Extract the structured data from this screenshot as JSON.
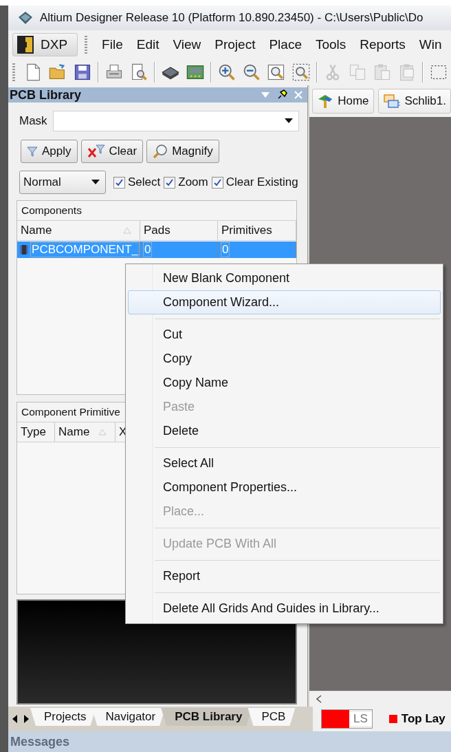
{
  "window": {
    "title": "Altium Designer Release 10 (Platform 10.890.23450) - C:\\Users\\Public\\Do"
  },
  "menu_bar": {
    "dxp": {
      "label": "DXP"
    },
    "items": [
      {
        "label": "File"
      },
      {
        "label": "Edit"
      },
      {
        "label": "View"
      },
      {
        "label": "Project"
      },
      {
        "label": "Place"
      },
      {
        "label": "Tools"
      },
      {
        "label": "Reports"
      },
      {
        "label": "Win"
      }
    ]
  },
  "panel": {
    "title": "PCB Library",
    "mask": {
      "label": "Mask"
    },
    "buttons": [
      {
        "label": "Apply",
        "kind": "apply"
      },
      {
        "label": "Clear",
        "kind": "clear"
      },
      {
        "label": "Magnify",
        "kind": "magnify"
      }
    ],
    "mode_select": {
      "value": "Normal"
    },
    "checkboxes": [
      {
        "label": "Select",
        "checked": true
      },
      {
        "label": "Zoom",
        "checked": true
      },
      {
        "label": "Clear Existing",
        "checked": true
      }
    ],
    "components": {
      "title": "Components",
      "columns": [
        {
          "label": "Name",
          "sorted": true
        },
        {
          "label": "Pads",
          "sorted": false
        },
        {
          "label": "Primitives",
          "sorted": false
        }
      ],
      "rows": [
        {
          "cells": [
            "PCBCOMPONENT_",
            "0",
            "0"
          ],
          "selected": true
        }
      ]
    },
    "primitives": {
      "title": "Component Primitive",
      "columns": [
        {
          "label": "Type"
        },
        {
          "label": "Name",
          "sorted": true
        },
        {
          "label": "X"
        }
      ]
    }
  },
  "doc_tabs": [
    {
      "label": "Home",
      "kind": "home"
    },
    {
      "label": "Schlib1.",
      "kind": "schlib"
    }
  ],
  "context_menu": [
    {
      "kind": "item",
      "label": "New Blank Component",
      "disabled": false,
      "selected": false
    },
    {
      "kind": "item",
      "label": "Component Wizard...",
      "disabled": false,
      "selected": true
    },
    {
      "kind": "separator"
    },
    {
      "kind": "item",
      "label": "Cut",
      "disabled": false,
      "selected": false
    },
    {
      "kind": "item",
      "label": "Copy",
      "disabled": false,
      "selected": false
    },
    {
      "kind": "item",
      "label": "Copy Name",
      "disabled": false,
      "selected": false
    },
    {
      "kind": "item",
      "label": "Paste",
      "disabled": true,
      "selected": false
    },
    {
      "kind": "item",
      "label": "Delete",
      "disabled": false,
      "selected": false
    },
    {
      "kind": "separator"
    },
    {
      "kind": "item",
      "label": "Select All",
      "disabled": false,
      "selected": false
    },
    {
      "kind": "item",
      "label": "Component Properties...",
      "disabled": false,
      "selected": false
    },
    {
      "kind": "item",
      "label": "Place...",
      "disabled": true,
      "selected": false
    },
    {
      "kind": "separator"
    },
    {
      "kind": "item",
      "label": "Update PCB With All",
      "disabled": true,
      "selected": false
    },
    {
      "kind": "separator"
    },
    {
      "kind": "item",
      "label": "Report",
      "disabled": false,
      "selected": false
    },
    {
      "kind": "separator"
    },
    {
      "kind": "item",
      "label": "Delete All Grids And Guides in Library...",
      "disabled": false,
      "selected": false
    }
  ],
  "bottom_tabs": [
    {
      "label": "Projects",
      "selected": false
    },
    {
      "label": "Navigator",
      "selected": false
    },
    {
      "label": "PCB Library",
      "selected": true
    },
    {
      "label": "PCB",
      "selected": false
    }
  ],
  "layer_bar": {
    "layer_set": {
      "label": "LS",
      "color": "#ff0000"
    },
    "layers": [
      {
        "label": "Top Lay",
        "color": "#ff0000"
      }
    ]
  },
  "messages": {
    "title": "Messages"
  }
}
